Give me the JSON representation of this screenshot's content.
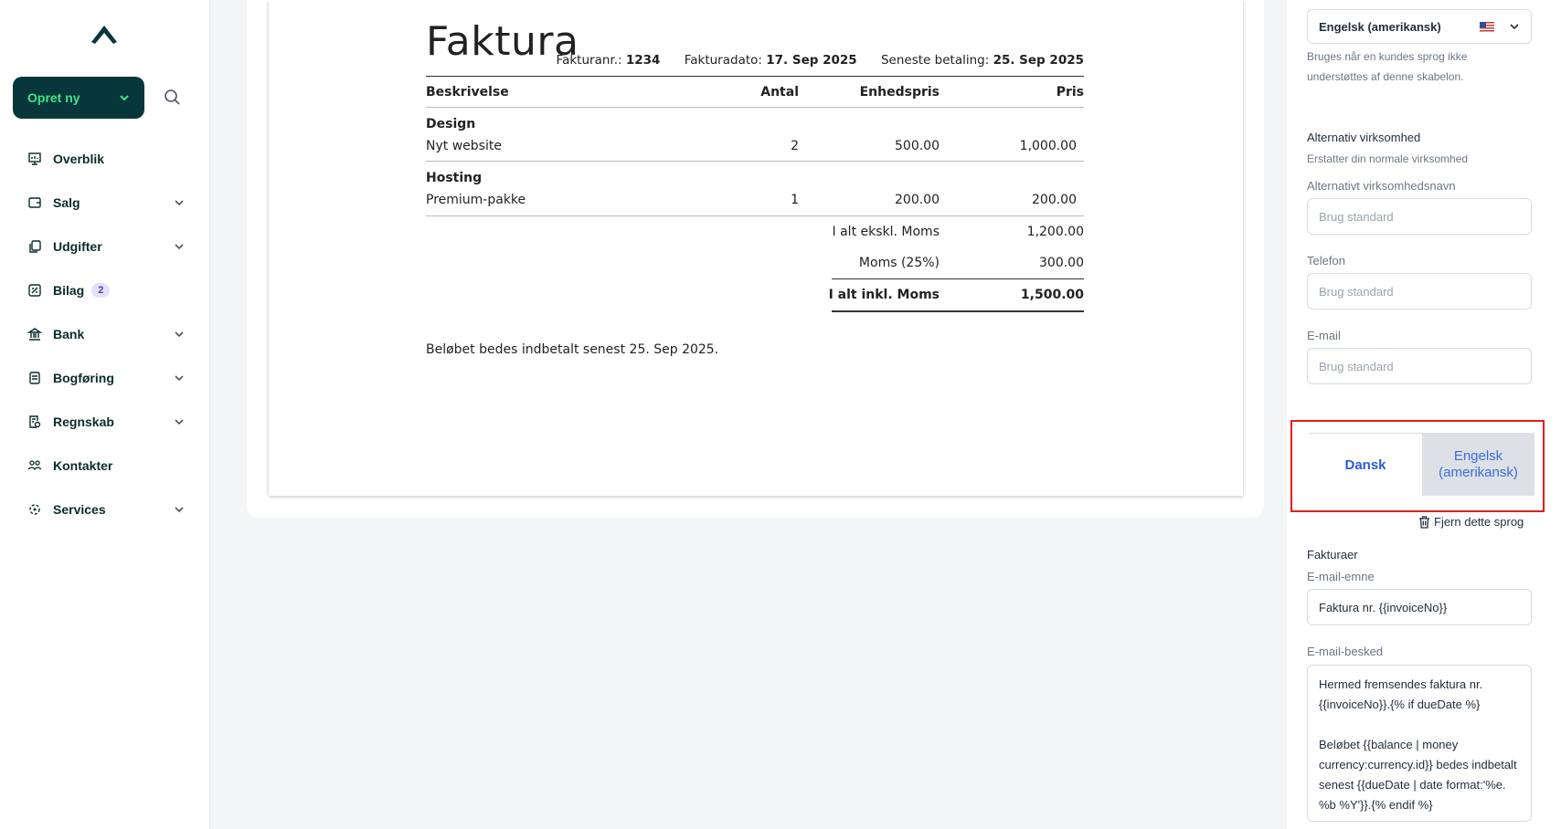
{
  "sidebar": {
    "create_label": "Opret ny",
    "items": [
      {
        "label": "Overblik",
        "icon": "presentation-icon"
      },
      {
        "label": "Salg",
        "icon": "wallet-icon"
      },
      {
        "label": "Udgifter",
        "icon": "copy-icon"
      },
      {
        "label": "Bilag",
        "icon": "receipt-icon",
        "badge": "2"
      },
      {
        "label": "Bank",
        "icon": "bank-icon"
      },
      {
        "label": "Bogføring",
        "icon": "ledger-icon"
      },
      {
        "label": "Regnskab",
        "icon": "report-icon"
      },
      {
        "label": "Kontakter",
        "icon": "people-icon"
      },
      {
        "label": "Services",
        "icon": "services-icon"
      }
    ]
  },
  "invoice": {
    "title": "Faktura",
    "number_label": "Fakturanr.:",
    "number": "1234",
    "date_label": "Fakturadato:",
    "date": "17. Sep 2025",
    "due_label": "Seneste betaling:",
    "due": "25. Sep 2025",
    "columns": [
      "Beskrivelse",
      "Antal",
      "Enhedspris",
      "Pris"
    ],
    "groups": [
      {
        "name": "Design",
        "line": "Nyt website",
        "qty": "2",
        "unit": "500.00",
        "price": "1,000.00"
      },
      {
        "name": "Hosting",
        "line": "Premium-pakke",
        "qty": "1",
        "unit": "200.00",
        "price": "200.00"
      }
    ],
    "subtotal_label": "I alt ekskl. Moms",
    "subtotal": "1,200.00",
    "vat_label": "Moms (25%)",
    "vat": "300.00",
    "total_label": "I alt inkl. Moms",
    "total": "1,500.00",
    "footer_note": "Beløbet bedes indbetalt senest 25. Sep 2025."
  },
  "panel": {
    "language_select": "Engelsk (amerikansk)",
    "language_help": "Bruges når en kundes sprog ikke understøttes af denne skabelon.",
    "alt_business_title": "Alternativ virksomhed",
    "alt_business_help": "Erstatter din normale virksomhed",
    "alt_name_label": "Alternativt virksomhedsnavn",
    "alt_name_placeholder": "Brug standard",
    "phone_label": "Telefon",
    "phone_placeholder": "Brug standard",
    "email_label": "E-mail",
    "email_placeholder": "Brug standard",
    "tab_dansk": "Dansk",
    "tab_english": "Engelsk (amerikansk)",
    "remove_language": "Fjern dette sprog",
    "invoices_title": "Fakturaer",
    "email_subject_label": "E-mail-emne",
    "email_subject_value": "Faktura nr. {{invoiceNo}}",
    "email_message_label": "E-mail-besked",
    "email_message_value": "Hermed fremsendes faktura nr. {{invoiceNo}}.{% if dueDate %}\n\nBeløbet {{balance | money currency:currency.id}} bedes indbetalt senest {{dueDate | date format:'%e. %b %Y'}}.{% endif %}"
  },
  "colors": {
    "brand_dark": "#07373a",
    "brand_green": "#43e38a",
    "highlight_red": "#e0201f",
    "link_blue": "#2a5bd7"
  }
}
